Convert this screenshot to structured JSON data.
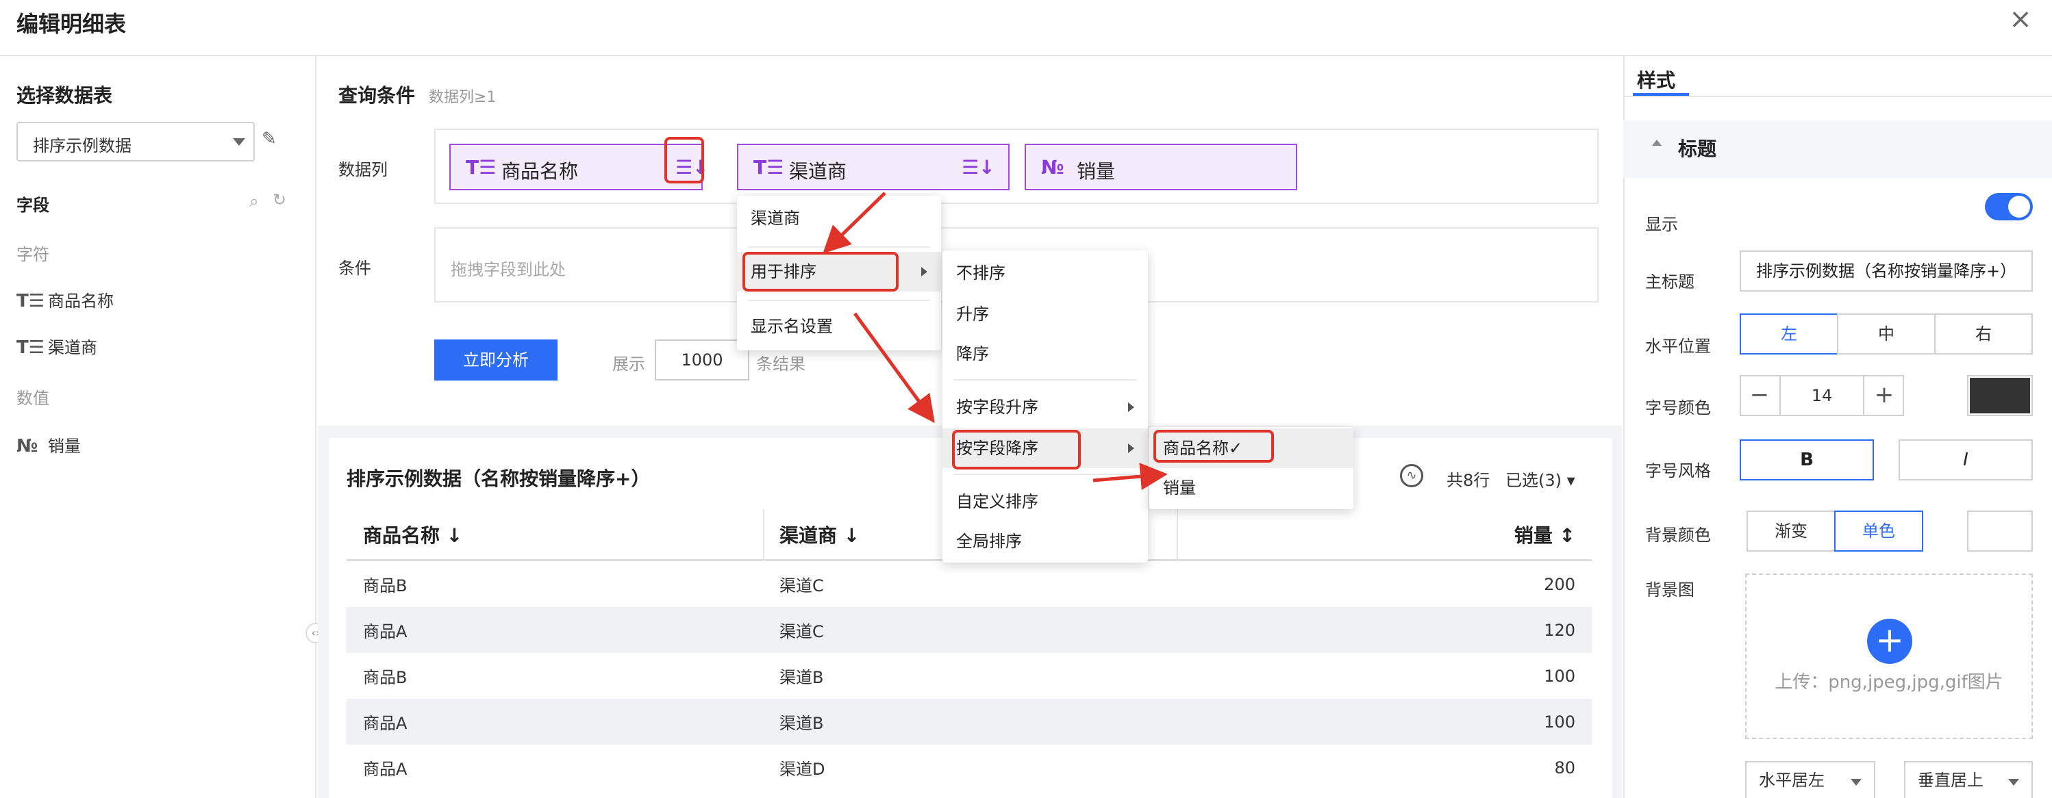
{
  "window": {
    "title": "编辑明细表",
    "close_icon": "close-icon"
  },
  "left": {
    "title": "选择数据表",
    "dataset_selected": "排序示例数据",
    "fields_title": "字段",
    "category_string": "字符",
    "string_fields": [
      "商品名称",
      "渠道商"
    ],
    "category_number": "数值",
    "number_fields": [
      "销量"
    ],
    "string_icon": "T☰",
    "number_icon": "№"
  },
  "query": {
    "title": "查询条件",
    "hint": "数据列≥1",
    "datacol_label": "数据列",
    "chips": [
      {
        "icon": "T☰",
        "label": "商品名称",
        "sort": "☰↓"
      },
      {
        "icon": "T☰",
        "label": "渠道商",
        "sort": "☰↓"
      },
      {
        "icon": "№",
        "label": "销量"
      }
    ],
    "cond_label": "条件",
    "cond_placeholder": "拖拽字段到此处",
    "analyze_label": "立即分析",
    "show_label": "展示",
    "show_value": "1000",
    "show_suffix": "条结果"
  },
  "menus": {
    "menu1": [
      "渠道商",
      "用于排序",
      "显示名设置"
    ],
    "menu2": [
      "不排序",
      "升序",
      "降序",
      "按字段升序",
      "按字段降序",
      "自定义排序",
      "全局排序"
    ],
    "menu3": [
      "商品名称✓",
      "销量"
    ]
  },
  "result": {
    "title": "排序示例数据（名称按销量降序+）",
    "count": "共8行",
    "selected": "已选(3) ▾",
    "columns": [
      "商品名称 ↓",
      "渠道商 ↓",
      "销量 ↕"
    ],
    "rows": [
      [
        "商品B",
        "渠道C",
        "200"
      ],
      [
        "商品A",
        "渠道C",
        "120"
      ],
      [
        "商品B",
        "渠道B",
        "100"
      ],
      [
        "商品A",
        "渠道B",
        "100"
      ],
      [
        "商品A",
        "渠道D",
        "80"
      ]
    ]
  },
  "style": {
    "tab": "样式",
    "section": "标题",
    "show_label": "显示",
    "show_enabled": true,
    "maintitle_label": "主标题",
    "maintitle_value": "排序示例数据（名称按销量降序+）",
    "halign_label": "水平位置",
    "halign_options": [
      "左",
      "中",
      "右"
    ],
    "halign_selected": "左",
    "fontsize_label": "字号颜色",
    "fontsize_value": "14",
    "font_color": "#333333",
    "fontstyle_label": "字号风格",
    "fontstyle_options": [
      "B",
      "I"
    ],
    "bgcolor_label": "背景颜色",
    "bgcolor_options": [
      "渐变",
      "单色"
    ],
    "bgcolor_selected": "单色",
    "bgimage_label": "背景图",
    "upload_text": "上传：png,jpeg,jpg,gif图片",
    "align_h": "水平居左",
    "align_v": "垂直居上"
  },
  "colors": {
    "accent": "#2d6cf5",
    "chip_border": "#a44ce0",
    "annotation_red": "#e0342a"
  }
}
